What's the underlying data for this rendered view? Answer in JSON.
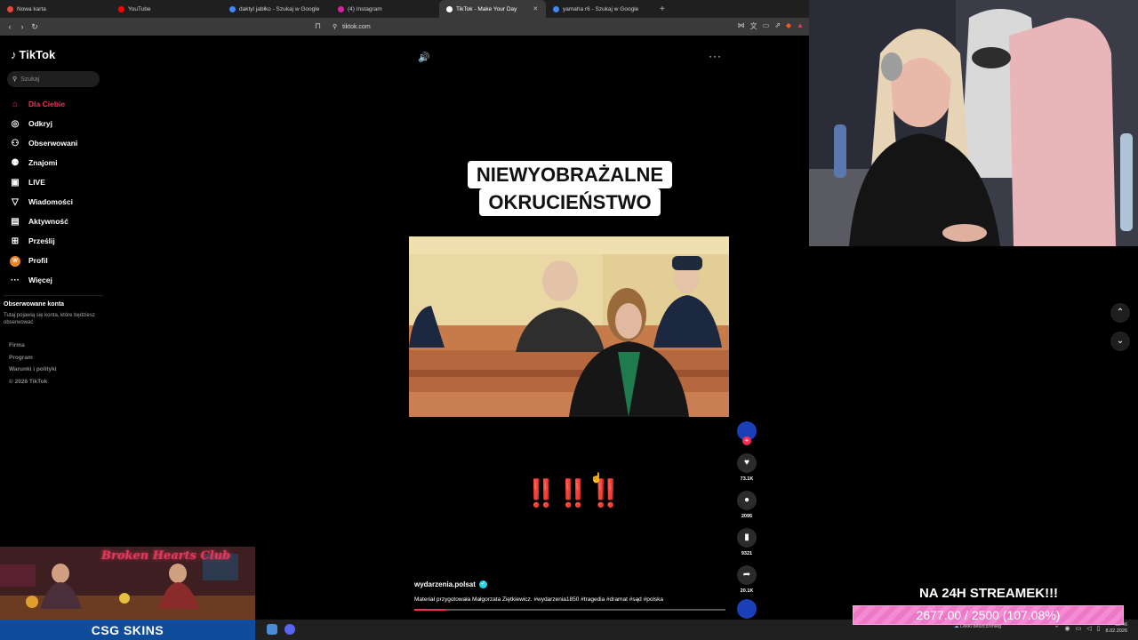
{
  "browser": {
    "tabs": [
      {
        "label": "Nowa karta",
        "color": "#e8453c"
      },
      {
        "label": "YouTube",
        "color": "#ff0000"
      },
      {
        "label": "daktyl jabłko - Szukaj w Google",
        "color": "#4285f4"
      },
      {
        "label": "(4) Instagram",
        "color": "#d6249f"
      },
      {
        "label": "TikTok - Make Your Day",
        "color": "#ffffff",
        "active": true
      },
      {
        "label": "yamaha r6 - Szukaj w Google",
        "color": "#4285f4"
      }
    ],
    "url": "tiktok.com"
  },
  "sidebar": {
    "logo": "TikTok",
    "search_placeholder": "Szukaj",
    "items": [
      {
        "label": "Dla Ciebie",
        "icon": "home-icon",
        "active": true
      },
      {
        "label": "Odkryj",
        "icon": "compass-icon"
      },
      {
        "label": "Obserwowani",
        "icon": "user-follow-icon"
      },
      {
        "label": "Znajomi",
        "icon": "friends-icon"
      },
      {
        "label": "LIVE",
        "icon": "live-icon"
      },
      {
        "label": "Wiadomości",
        "icon": "message-icon"
      },
      {
        "label": "Aktywność",
        "icon": "activity-icon"
      },
      {
        "label": "Prześlij",
        "icon": "upload-icon"
      },
      {
        "label": "Profil",
        "icon": "profile-avatar"
      },
      {
        "label": "Więcej",
        "icon": "more-icon"
      }
    ],
    "followed_title": "Obserwowane konta",
    "followed_sub": "Tutaj pojawią się konta, które będziesz obserwować",
    "footer": [
      "Firma",
      "Program",
      "Warunki i polityki",
      "© 2026 TikTok"
    ]
  },
  "video": {
    "headline_line1": "NIEWYOBRAŻALNE",
    "headline_line2": "OKRUCIEŃSTWO",
    "exclamations": "‼️‼️‼️",
    "author": "wydarzenia.polsat",
    "caption": "Materiał przygotowała Małgorzata Ziętkiewicz. #wydarzenia1850 #tragedia #dramat #sąd #polska",
    "progress": 0.1
  },
  "actions": {
    "likes": "73.1K",
    "comments": "2095",
    "saves": "9321",
    "shares": "20.1K"
  },
  "overlay": {
    "ad_title": "Broken Hearts Club",
    "sponsor": "CSG SKINS",
    "goal_title": "NA 24H STREAMEK!!!",
    "goal_progress": "2677.00 / 2500 (107.08%)"
  },
  "taskbar": {
    "weather": "Lekki deszcz/śnieg",
    "time": "02:46",
    "date": "8.02.2026"
  }
}
